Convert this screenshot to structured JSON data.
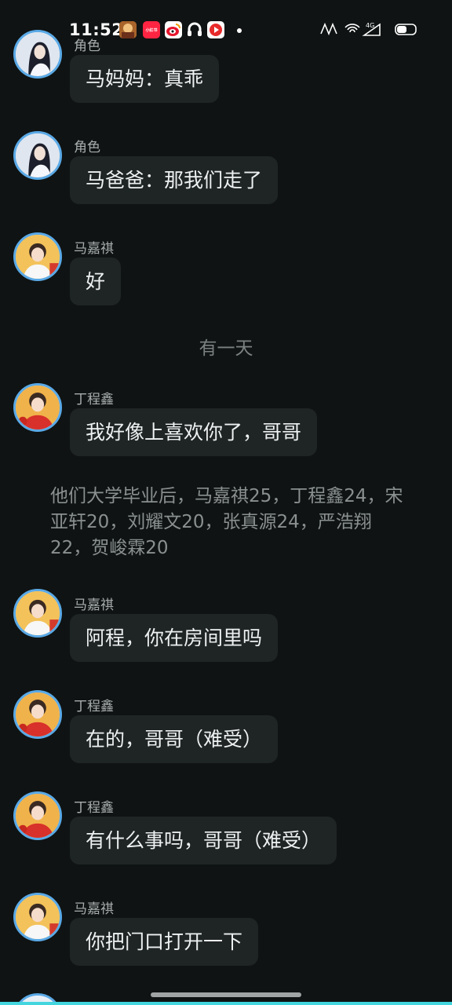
{
  "status_bar": {
    "time": "11:52",
    "app_icons": [
      "game-icon",
      "xiaohongshu-icon",
      "weibo-icon",
      "earbuds-app-icon",
      "video-app-icon"
    ],
    "right_icons": [
      "nfc-icon",
      "wifi-icon",
      "signal-4g-icon",
      "battery-icon"
    ],
    "xiaohongshu_text": "小红书",
    "network_text": "4G"
  },
  "chat": {
    "messages": [
      {
        "sender": "角色",
        "text": "马妈妈：真乖",
        "avatar": "girl-avatar"
      },
      {
        "sender": "角色",
        "text": "马爸爸：那我们走了",
        "avatar": "girl-avatar"
      },
      {
        "sender": "马嘉祺",
        "text": "好",
        "avatar": "boy-avatar-white"
      },
      {
        "sender": "丁程鑫",
        "text": "我好像上喜欢你了，哥哥",
        "avatar": "boy-avatar-red"
      },
      {
        "sender": "马嘉祺",
        "text": "阿程，你在房间里吗",
        "avatar": "boy-avatar-white"
      },
      {
        "sender": "丁程鑫",
        "text": "在的，哥哥（难受）",
        "avatar": "boy-avatar-red"
      },
      {
        "sender": "丁程鑫",
        "text": "有什么事吗，哥哥（难受）",
        "avatar": "boy-avatar-red"
      },
      {
        "sender": "马嘉祺",
        "text": "你把门口打开一下",
        "avatar": "boy-avatar-white"
      }
    ],
    "divider": "有一天",
    "narration": "他们大学毕业后，马嘉祺25，丁程鑫24，宋亚轩20，刘耀文20，张真源24，严浩翔22，贺峻霖20"
  },
  "colors": {
    "background": "#0f1313",
    "bubble": "#1f2424",
    "avatar_ring": "#5aa9e6",
    "accent_bottom": "#43d6df"
  }
}
